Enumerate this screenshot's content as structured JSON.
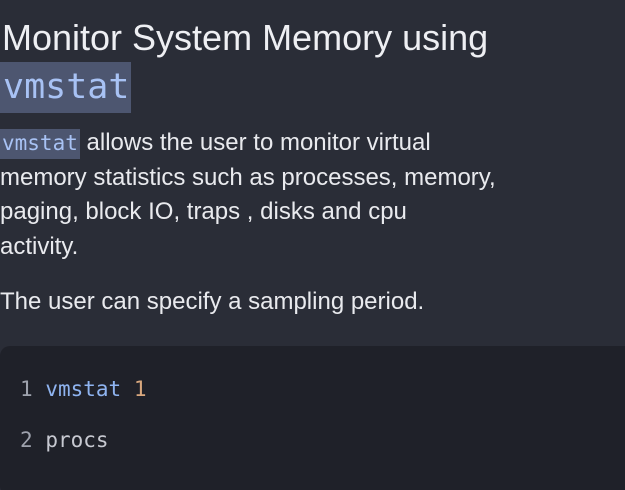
{
  "heading": {
    "text": "Monitor System Memory using",
    "code": "vmstat"
  },
  "paragraph1": {
    "code": "vmstat",
    "line1_rest": " allows the user to monitor virtual",
    "line2": "memory statistics such as processes, memory,",
    "line3": "paging, block IO, traps , disks and cpu",
    "line4": "activity."
  },
  "paragraph2": {
    "text": "The user can specify a sampling period."
  },
  "code_block": {
    "lines": [
      {
        "number": "1",
        "command": "vmstat",
        "arg": "1"
      },
      {
        "number": "2",
        "text": "procs"
      }
    ]
  },
  "colors": {
    "background": "#2a2d37",
    "code_background": "#1f2129",
    "inline_code_bg": "#4d5670",
    "inline_code_fg": "#a8c2f4",
    "number_accent": "#d9a87e"
  }
}
